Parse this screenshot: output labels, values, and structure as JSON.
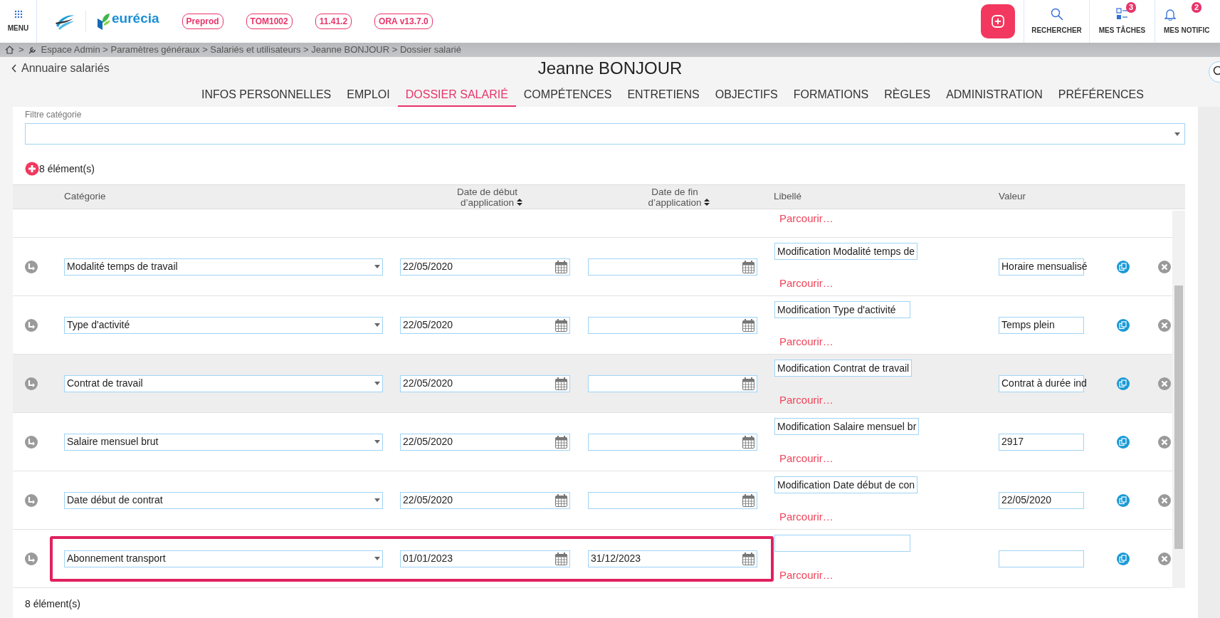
{
  "topbar": {
    "menu_label": "MENU",
    "brand": "eurécia",
    "badges": [
      "Preprod",
      "TOM1002",
      "11.41.2",
      "ORA v13.7.0"
    ],
    "actions": [
      {
        "kind": "search",
        "label": "RECHERCHER"
      },
      {
        "kind": "tasks",
        "label": "MES TÂCHES",
        "count": "3"
      },
      {
        "kind": "notifications",
        "label": "MES NOTIFIC",
        "count": "2"
      }
    ]
  },
  "breadcrumb": {
    "separator": ">",
    "path": "Espace Admin > Paramètres généraux > Salariés et utilisateurs > Jeanne BONJOUR > Dossier salarié"
  },
  "back_link": "Annuaire salariés",
  "title": "Jeanne BONJOUR",
  "tabs": [
    {
      "label": "INFOS PERSONNELLES",
      "selected": false
    },
    {
      "label": "EMPLOI",
      "selected": false
    },
    {
      "label": "DOSSIER SALARIÉ",
      "selected": true
    },
    {
      "label": "COMPÉTENCES",
      "selected": false
    },
    {
      "label": "ENTRETIENS",
      "selected": false
    },
    {
      "label": "OBJECTIFS",
      "selected": false
    },
    {
      "label": "FORMATIONS",
      "selected": false
    },
    {
      "label": "RÈGLES",
      "selected": false
    },
    {
      "label": "ADMINISTRATION",
      "selected": false
    },
    {
      "label": "PRÉFÉRENCES",
      "selected": false
    }
  ],
  "filter": {
    "label": "Filtre catégorie"
  },
  "count_top": "8 élément(s)",
  "table": {
    "columns": [
      {
        "label": "Catégorie",
        "sortable": false
      },
      {
        "label": "Date de début d’application",
        "sortable": true
      },
      {
        "label": "Date de fin d’application",
        "sortable": true
      },
      {
        "label": "Libellé",
        "sortable": false
      },
      {
        "label": "Valeur",
        "sortable": false
      }
    ],
    "rows": [
      {
        "kind": "partial",
        "browse": "Parcourir…"
      },
      {
        "kind": "full",
        "category": "Modalité temps de travail",
        "start": "22/05/2020",
        "label": "Modification Modalité temps de",
        "value": "Horaire mensualisé",
        "browse": "Parcourir…",
        "hovered": false,
        "highlighted": false
      },
      {
        "kind": "full",
        "category": "Type d'activité",
        "start": "22/05/2020",
        "label": "Modification Type d'activité",
        "value": "Temps plein",
        "browse": "Parcourir…",
        "hovered": false,
        "highlighted": false
      },
      {
        "kind": "full",
        "category": "Contrat de travail",
        "start": "22/05/2020",
        "label": "Modification Contrat de travail",
        "value": "Contrat à durée ind",
        "browse": "Parcourir…",
        "hovered": true,
        "highlighted": false
      },
      {
        "kind": "full",
        "category": "Salaire mensuel brut",
        "start": "22/05/2020",
        "label": "Modification Salaire mensuel br",
        "value": "2917",
        "browse": "Parcourir…",
        "hovered": false,
        "highlighted": false
      },
      {
        "kind": "full",
        "category": "Date début de contrat",
        "start": "22/05/2020",
        "label": "Modification Date début de con",
        "value": "22/05/2020",
        "browse": "Parcourir…",
        "hovered": false,
        "highlighted": false
      },
      {
        "kind": "full",
        "category": "Abonnement transport",
        "start": "01/01/2023",
        "end": "31/12/2023",
        "browse": "Parcourir…",
        "hovered": false,
        "highlighted": true
      }
    ]
  },
  "count_bottom": "8 élément(s)"
}
